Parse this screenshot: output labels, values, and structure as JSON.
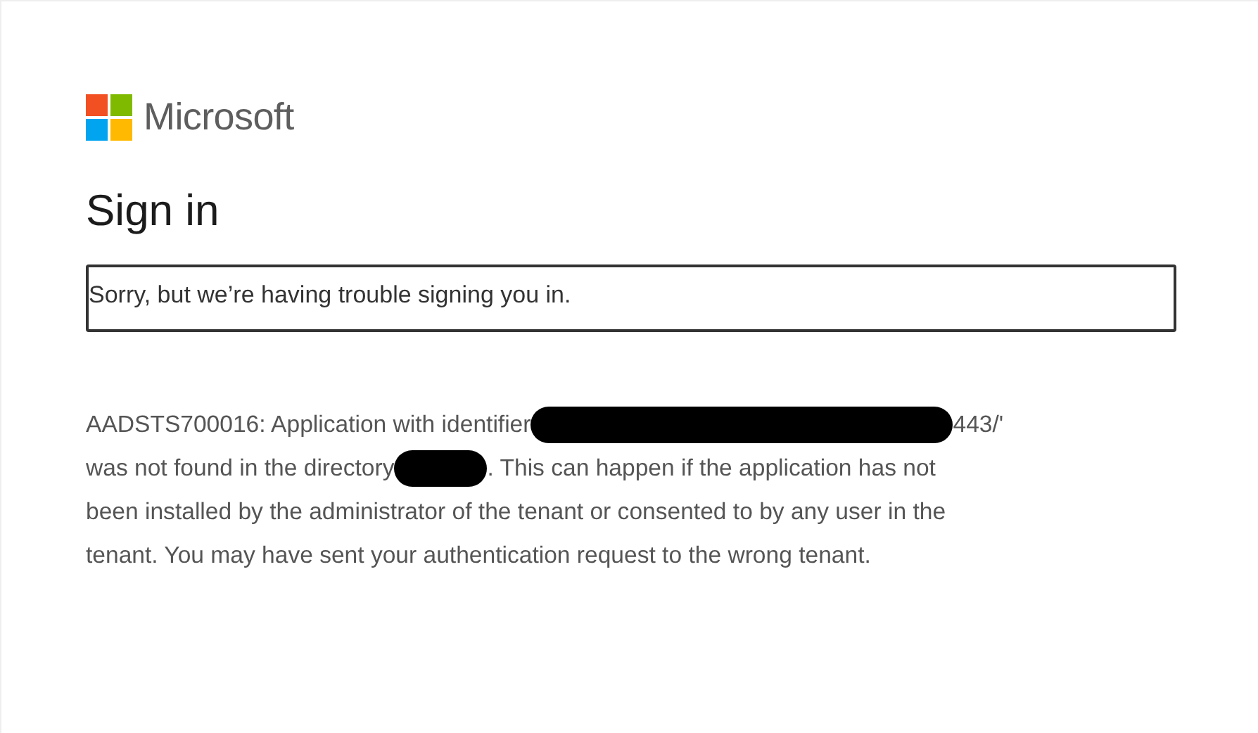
{
  "brand": {
    "name": "Microsoft"
  },
  "title": "Sign in",
  "alert": "Sorry, but we’re having trouble signing you in.",
  "details": [
    [
      {
        "kind": "text",
        "text": "AADSTS700016: Application with identifier"
      },
      {
        "kind": "redaction"
      },
      {
        "kind": "text",
        "text": "443/'"
      }
    ],
    [
      {
        "kind": "text",
        "text": "was not found in the directory"
      },
      {
        "kind": "redaction"
      },
      {
        "kind": "text",
        "text": ". This can happen if the application has not"
      }
    ],
    [
      {
        "kind": "text",
        "text": "been installed by the administrator of the tenant or consented to by any user in the"
      }
    ],
    [
      {
        "kind": "text",
        "text": "tenant. You may have sent your authentication request to the wrong tenant."
      }
    ]
  ]
}
